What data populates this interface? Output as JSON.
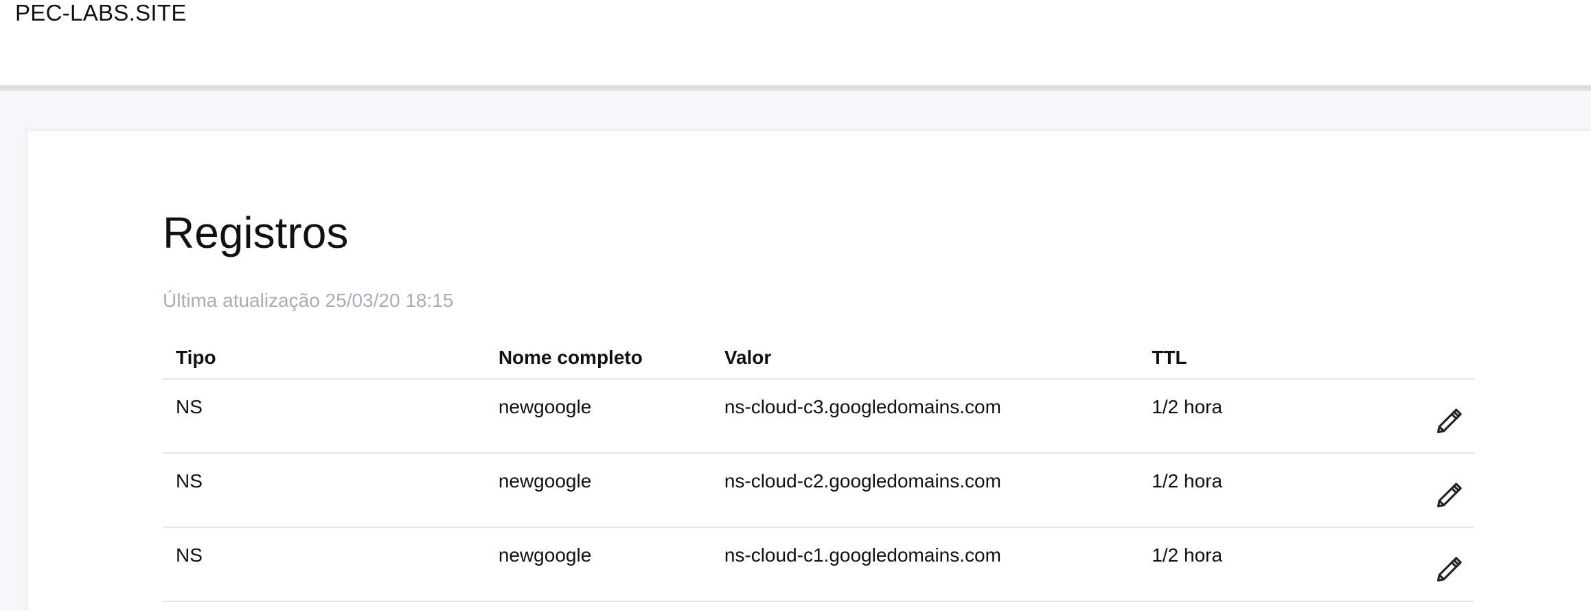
{
  "header": {
    "site_name": "PEC-LABS.SITE"
  },
  "records_section": {
    "title": "Registros",
    "last_updated": "Última atualização 25/03/20 18:15",
    "columns": {
      "type": "Tipo",
      "name": "Nome completo",
      "value": "Valor",
      "ttl": "TTL"
    },
    "rows": [
      {
        "type": "NS",
        "name": "newgoogle",
        "value": "ns-cloud-c3.googledomains.com",
        "ttl": "1/2 hora",
        "edit_icon": "pencil-icon"
      },
      {
        "type": "NS",
        "name": "newgoogle",
        "value": "ns-cloud-c2.googledomains.com",
        "ttl": "1/2 hora",
        "edit_icon": "pencil-icon"
      },
      {
        "type": "NS",
        "name": "newgoogle",
        "value": "ns-cloud-c1.googledomains.com",
        "ttl": "1/2 hora",
        "edit_icon": "pencil-icon"
      }
    ]
  },
  "colors": {
    "background": "#f5f6f7",
    "text": "#111111",
    "muted_text": "#a7aeb4",
    "divider": "#e6e6e6"
  }
}
